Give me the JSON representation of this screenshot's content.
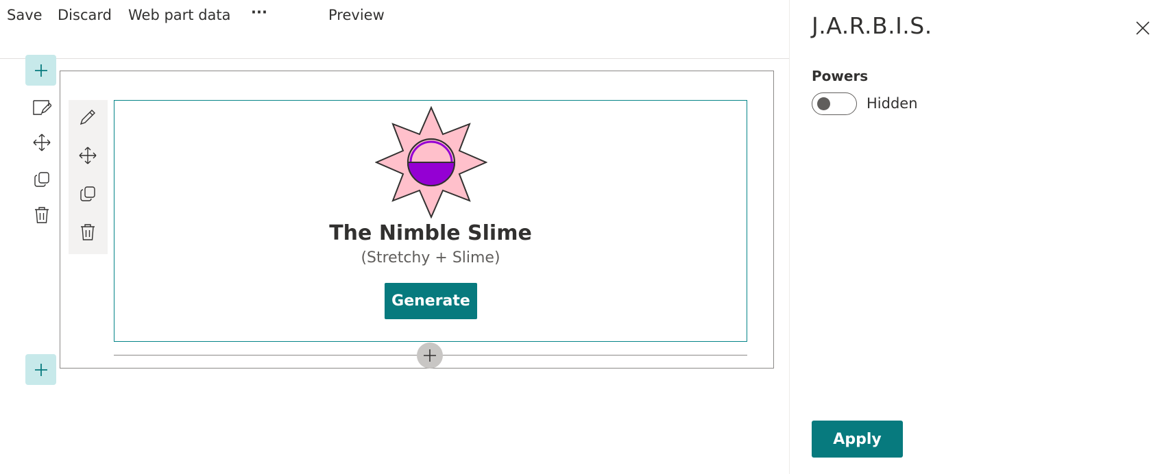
{
  "commandbar": {
    "save": "Save",
    "discard": "Discard",
    "webpart_data": "Web part data",
    "more": "···",
    "preview": "Preview"
  },
  "webpart": {
    "title": "The Nimble Slime",
    "subtitle": "(Stretchy + Slime)",
    "generate_label": "Generate"
  },
  "panel": {
    "title": "J.A.R.B.I.S.",
    "field_label": "Powers",
    "toggle_state": "Hidden",
    "apply_label": "Apply"
  },
  "colors": {
    "accent": "#077a7e",
    "emblem_fill": "#ffc0cb",
    "emblem_center": "#9400d3"
  }
}
